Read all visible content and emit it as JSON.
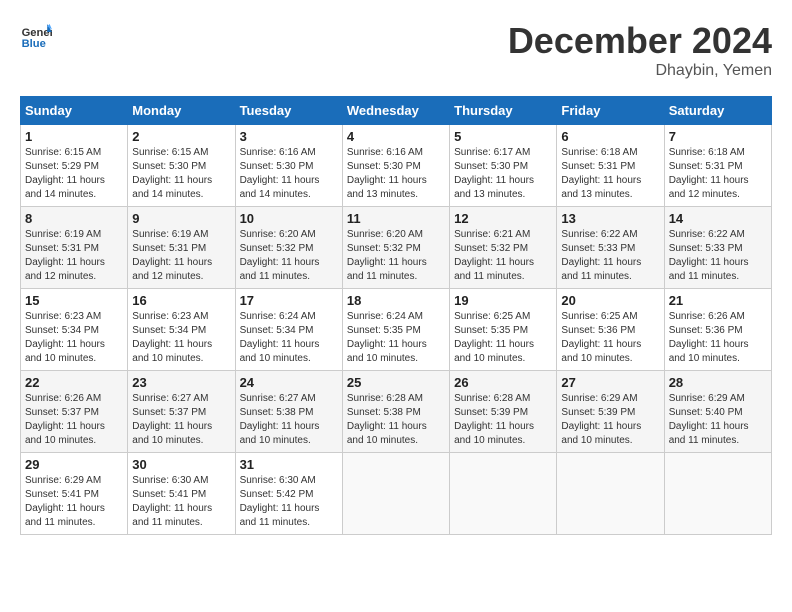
{
  "header": {
    "logo_line1": "General",
    "logo_line2": "Blue",
    "month": "December 2024",
    "location": "Dhaybin, Yemen"
  },
  "weekdays": [
    "Sunday",
    "Monday",
    "Tuesday",
    "Wednesday",
    "Thursday",
    "Friday",
    "Saturday"
  ],
  "weeks": [
    [
      {
        "day": "1",
        "sunrise": "6:15 AM",
        "sunset": "5:29 PM",
        "daylight": "11 hours and 14 minutes."
      },
      {
        "day": "2",
        "sunrise": "6:15 AM",
        "sunset": "5:30 PM",
        "daylight": "11 hours and 14 minutes."
      },
      {
        "day": "3",
        "sunrise": "6:16 AM",
        "sunset": "5:30 PM",
        "daylight": "11 hours and 14 minutes."
      },
      {
        "day": "4",
        "sunrise": "6:16 AM",
        "sunset": "5:30 PM",
        "daylight": "11 hours and 13 minutes."
      },
      {
        "day": "5",
        "sunrise": "6:17 AM",
        "sunset": "5:30 PM",
        "daylight": "11 hours and 13 minutes."
      },
      {
        "day": "6",
        "sunrise": "6:18 AM",
        "sunset": "5:31 PM",
        "daylight": "11 hours and 13 minutes."
      },
      {
        "day": "7",
        "sunrise": "6:18 AM",
        "sunset": "5:31 PM",
        "daylight": "11 hours and 12 minutes."
      }
    ],
    [
      {
        "day": "8",
        "sunrise": "6:19 AM",
        "sunset": "5:31 PM",
        "daylight": "11 hours and 12 minutes."
      },
      {
        "day": "9",
        "sunrise": "6:19 AM",
        "sunset": "5:31 PM",
        "daylight": "11 hours and 12 minutes."
      },
      {
        "day": "10",
        "sunrise": "6:20 AM",
        "sunset": "5:32 PM",
        "daylight": "11 hours and 11 minutes."
      },
      {
        "day": "11",
        "sunrise": "6:20 AM",
        "sunset": "5:32 PM",
        "daylight": "11 hours and 11 minutes."
      },
      {
        "day": "12",
        "sunrise": "6:21 AM",
        "sunset": "5:32 PM",
        "daylight": "11 hours and 11 minutes."
      },
      {
        "day": "13",
        "sunrise": "6:22 AM",
        "sunset": "5:33 PM",
        "daylight": "11 hours and 11 minutes."
      },
      {
        "day": "14",
        "sunrise": "6:22 AM",
        "sunset": "5:33 PM",
        "daylight": "11 hours and 11 minutes."
      }
    ],
    [
      {
        "day": "15",
        "sunrise": "6:23 AM",
        "sunset": "5:34 PM",
        "daylight": "11 hours and 10 minutes."
      },
      {
        "day": "16",
        "sunrise": "6:23 AM",
        "sunset": "5:34 PM",
        "daylight": "11 hours and 10 minutes."
      },
      {
        "day": "17",
        "sunrise": "6:24 AM",
        "sunset": "5:34 PM",
        "daylight": "11 hours and 10 minutes."
      },
      {
        "day": "18",
        "sunrise": "6:24 AM",
        "sunset": "5:35 PM",
        "daylight": "11 hours and 10 minutes."
      },
      {
        "day": "19",
        "sunrise": "6:25 AM",
        "sunset": "5:35 PM",
        "daylight": "11 hours and 10 minutes."
      },
      {
        "day": "20",
        "sunrise": "6:25 AM",
        "sunset": "5:36 PM",
        "daylight": "11 hours and 10 minutes."
      },
      {
        "day": "21",
        "sunrise": "6:26 AM",
        "sunset": "5:36 PM",
        "daylight": "11 hours and 10 minutes."
      }
    ],
    [
      {
        "day": "22",
        "sunrise": "6:26 AM",
        "sunset": "5:37 PM",
        "daylight": "11 hours and 10 minutes."
      },
      {
        "day": "23",
        "sunrise": "6:27 AM",
        "sunset": "5:37 PM",
        "daylight": "11 hours and 10 minutes."
      },
      {
        "day": "24",
        "sunrise": "6:27 AM",
        "sunset": "5:38 PM",
        "daylight": "11 hours and 10 minutes."
      },
      {
        "day": "25",
        "sunrise": "6:28 AM",
        "sunset": "5:38 PM",
        "daylight": "11 hours and 10 minutes."
      },
      {
        "day": "26",
        "sunrise": "6:28 AM",
        "sunset": "5:39 PM",
        "daylight": "11 hours and 10 minutes."
      },
      {
        "day": "27",
        "sunrise": "6:29 AM",
        "sunset": "5:39 PM",
        "daylight": "11 hours and 10 minutes."
      },
      {
        "day": "28",
        "sunrise": "6:29 AM",
        "sunset": "5:40 PM",
        "daylight": "11 hours and 11 minutes."
      }
    ],
    [
      {
        "day": "29",
        "sunrise": "6:29 AM",
        "sunset": "5:41 PM",
        "daylight": "11 hours and 11 minutes."
      },
      {
        "day": "30",
        "sunrise": "6:30 AM",
        "sunset": "5:41 PM",
        "daylight": "11 hours and 11 minutes."
      },
      {
        "day": "31",
        "sunrise": "6:30 AM",
        "sunset": "5:42 PM",
        "daylight": "11 hours and 11 minutes."
      },
      null,
      null,
      null,
      null
    ]
  ]
}
